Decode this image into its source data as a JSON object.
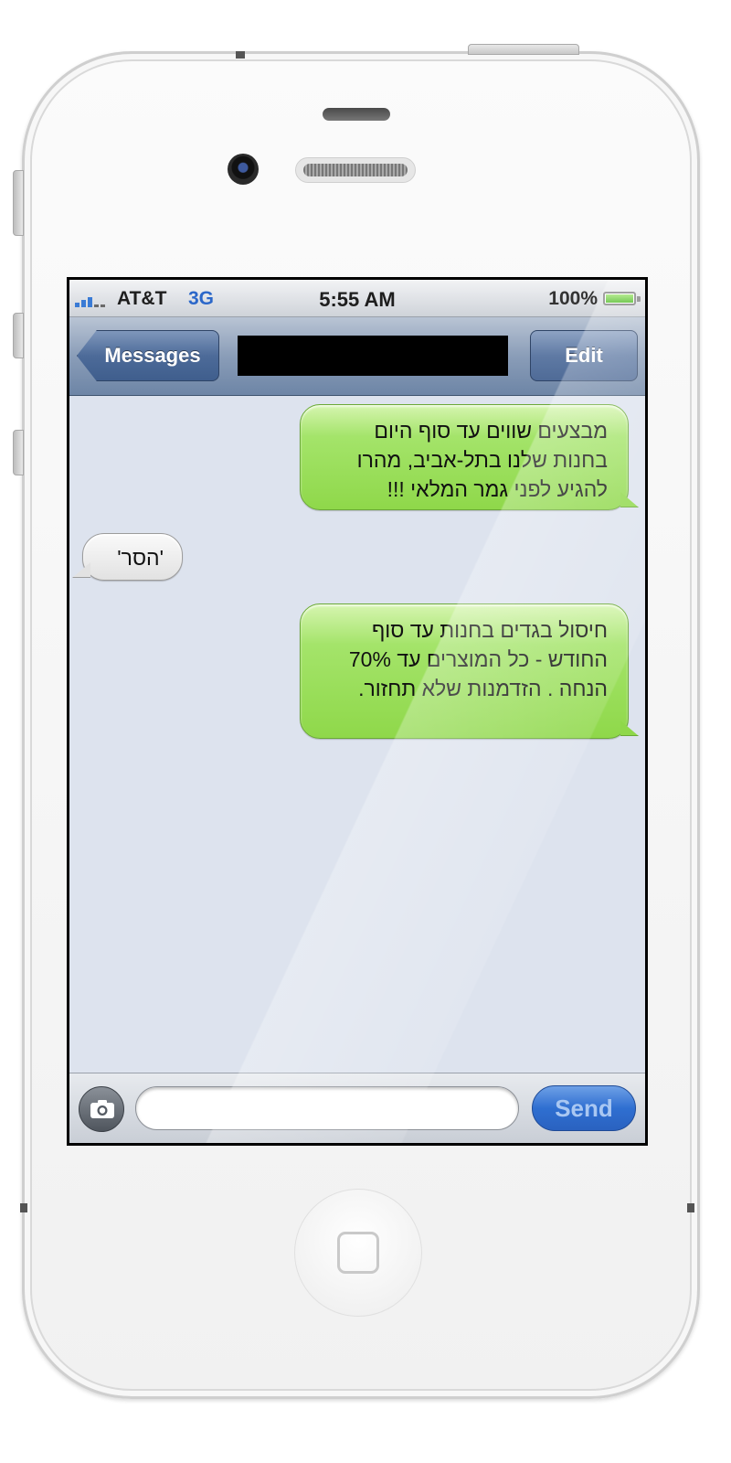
{
  "status_bar": {
    "carrier": "AT&T",
    "network": "3G",
    "time": "5:55 AM",
    "battery_percent": "100%"
  },
  "nav": {
    "back_label": "Messages",
    "edit_label": "Edit"
  },
  "messages": [
    {
      "type": "sent",
      "text": "מבצעים שווים עד סוף היום בחנות שלנו בתל-אביב, מהרו להגיע לפני גמר המלאי !!!"
    },
    {
      "type": "received",
      "text": "'הסר'"
    },
    {
      "type": "sent",
      "text": "חיסול בגדים בחנות עד סוף החודש - כל המוצרים עד 70% הנחה . הזדמנות שלא תחזור."
    }
  ],
  "compose": {
    "input_value": "",
    "send_label": "Send"
  },
  "colors": {
    "sent_bubble": "#8fd84a",
    "received_bubble": "#e2e2e2",
    "network_3g": "#2b67c9",
    "send_button": "#2f6fd1"
  },
  "icons": [
    "camera-icon",
    "signal-icon",
    "battery-icon",
    "home-button-icon"
  ]
}
